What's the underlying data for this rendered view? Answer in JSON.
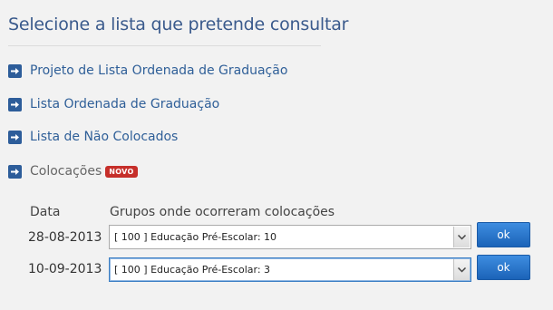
{
  "page": {
    "title": "Selecione a lista que pretende consultar"
  },
  "nav": [
    {
      "label": "Projeto de Lista Ordenada de Graduação",
      "icon": "arrow-right-icon"
    },
    {
      "label": "Lista Ordenada de Graduação",
      "icon": "arrow-right-icon"
    },
    {
      "label": "Lista de Não Colocados",
      "icon": "arrow-right-icon"
    },
    {
      "label": "Colocações",
      "icon": "arrow-right-icon",
      "badge": "NOVO",
      "badge_color": "#c62f2a"
    }
  ],
  "placements": {
    "col_date": "Data",
    "col_groups": "Grupos onde ocorreram colocações",
    "rows": [
      {
        "date": "28-08-2013",
        "selected": "[ 100 ]  Educação Pré-Escolar: 10",
        "button": "ok"
      },
      {
        "date": "10-09-2013",
        "selected": "[ 100 ]  Educação Pré-Escolar: 3",
        "button": "ok"
      }
    ]
  },
  "colors": {
    "accent": "#2d5d9a",
    "button": "#2a76cf",
    "badge": "#c62f2a"
  }
}
